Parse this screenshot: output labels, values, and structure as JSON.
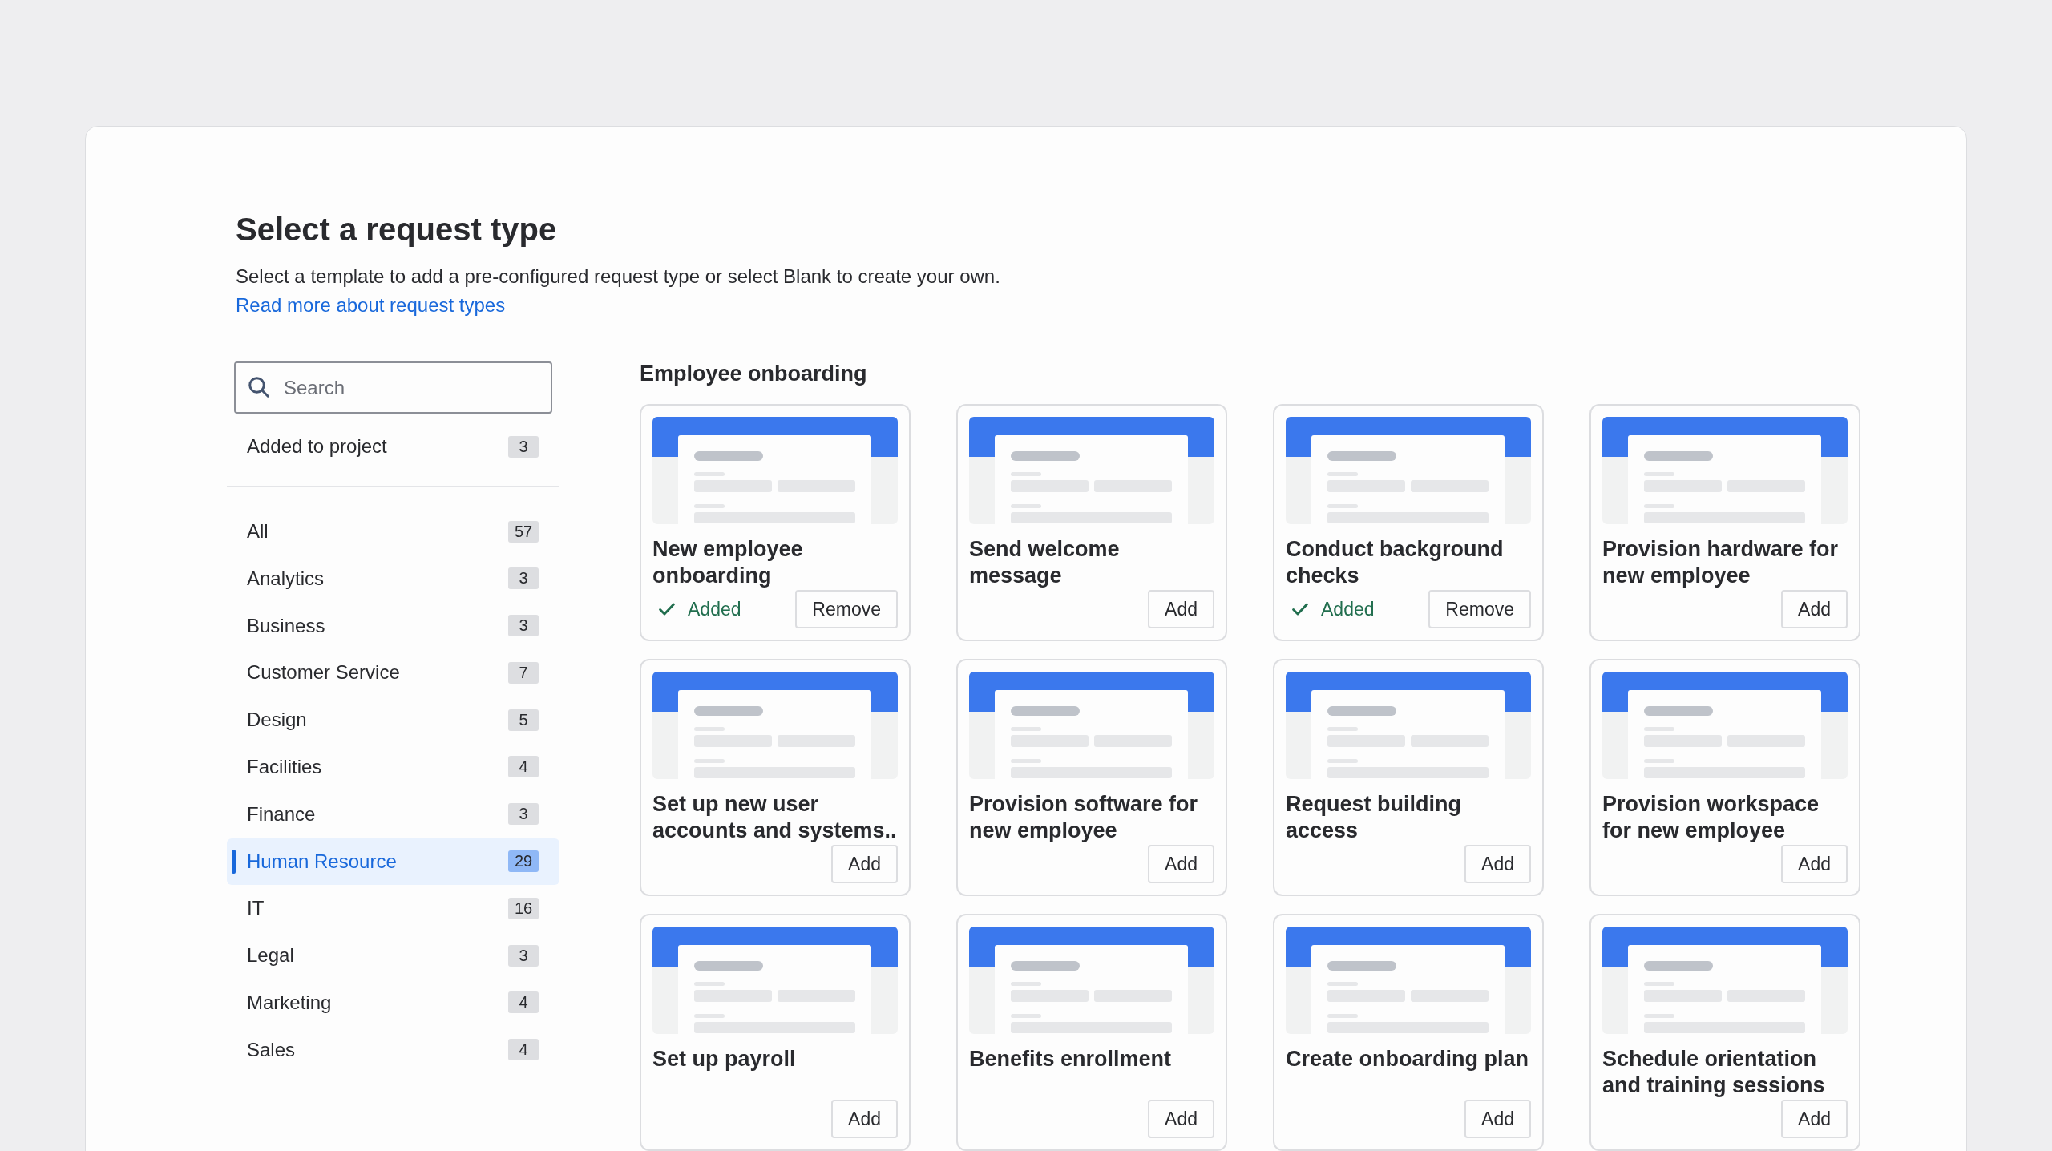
{
  "title": "Select a request type",
  "description": "Select a template to add a pre-configured request type or select Blank to create your own.",
  "link": "Read more about request types",
  "search": {
    "placeholder": "Search"
  },
  "added_filter": {
    "label": "Added to project",
    "count": "3",
    "selected": false
  },
  "categories": [
    {
      "label": "All",
      "count": "57",
      "selected": false
    },
    {
      "label": "Analytics",
      "count": "3",
      "selected": false
    },
    {
      "label": "Business",
      "count": "3",
      "selected": false
    },
    {
      "label": "Customer Service",
      "count": "7",
      "selected": false
    },
    {
      "label": "Design",
      "count": "5",
      "selected": false
    },
    {
      "label": "Facilities",
      "count": "4",
      "selected": false
    },
    {
      "label": "Finance",
      "count": "3",
      "selected": false
    },
    {
      "label": "Human Resource",
      "count": "29",
      "selected": true
    },
    {
      "label": "IT",
      "count": "16",
      "selected": false
    },
    {
      "label": "Legal",
      "count": "3",
      "selected": false
    },
    {
      "label": "Marketing",
      "count": "4",
      "selected": false
    },
    {
      "label": "Sales",
      "count": "4",
      "selected": false
    }
  ],
  "section": {
    "title": "Employee onboarding",
    "cards": [
      {
        "title": "New employee onboarding",
        "added": true,
        "status": "Added",
        "button": "Remove"
      },
      {
        "title": "Send welcome message",
        "added": false,
        "button": "Add"
      },
      {
        "title": "Conduct background checks",
        "added": true,
        "status": "Added",
        "button": "Remove"
      },
      {
        "title": "Provision hardware for new employee",
        "added": false,
        "button": "Add"
      },
      {
        "title": "Set up new user accounts and systems..",
        "added": false,
        "button": "Add"
      },
      {
        "title": "Provision software for new employee",
        "added": false,
        "button": "Add"
      },
      {
        "title": "Request building access",
        "added": false,
        "button": "Add"
      },
      {
        "title": "Provision workspace for new employee",
        "added": false,
        "button": "Add"
      },
      {
        "title": "Set up payroll",
        "added": false,
        "button": "Add"
      },
      {
        "title": "Benefits enrollment",
        "added": false,
        "button": "Add"
      },
      {
        "title": "Create onboarding plan",
        "added": false,
        "button": "Add"
      },
      {
        "title": "Schedule orientation and training sessions",
        "added": false,
        "button": "Add"
      }
    ]
  }
}
